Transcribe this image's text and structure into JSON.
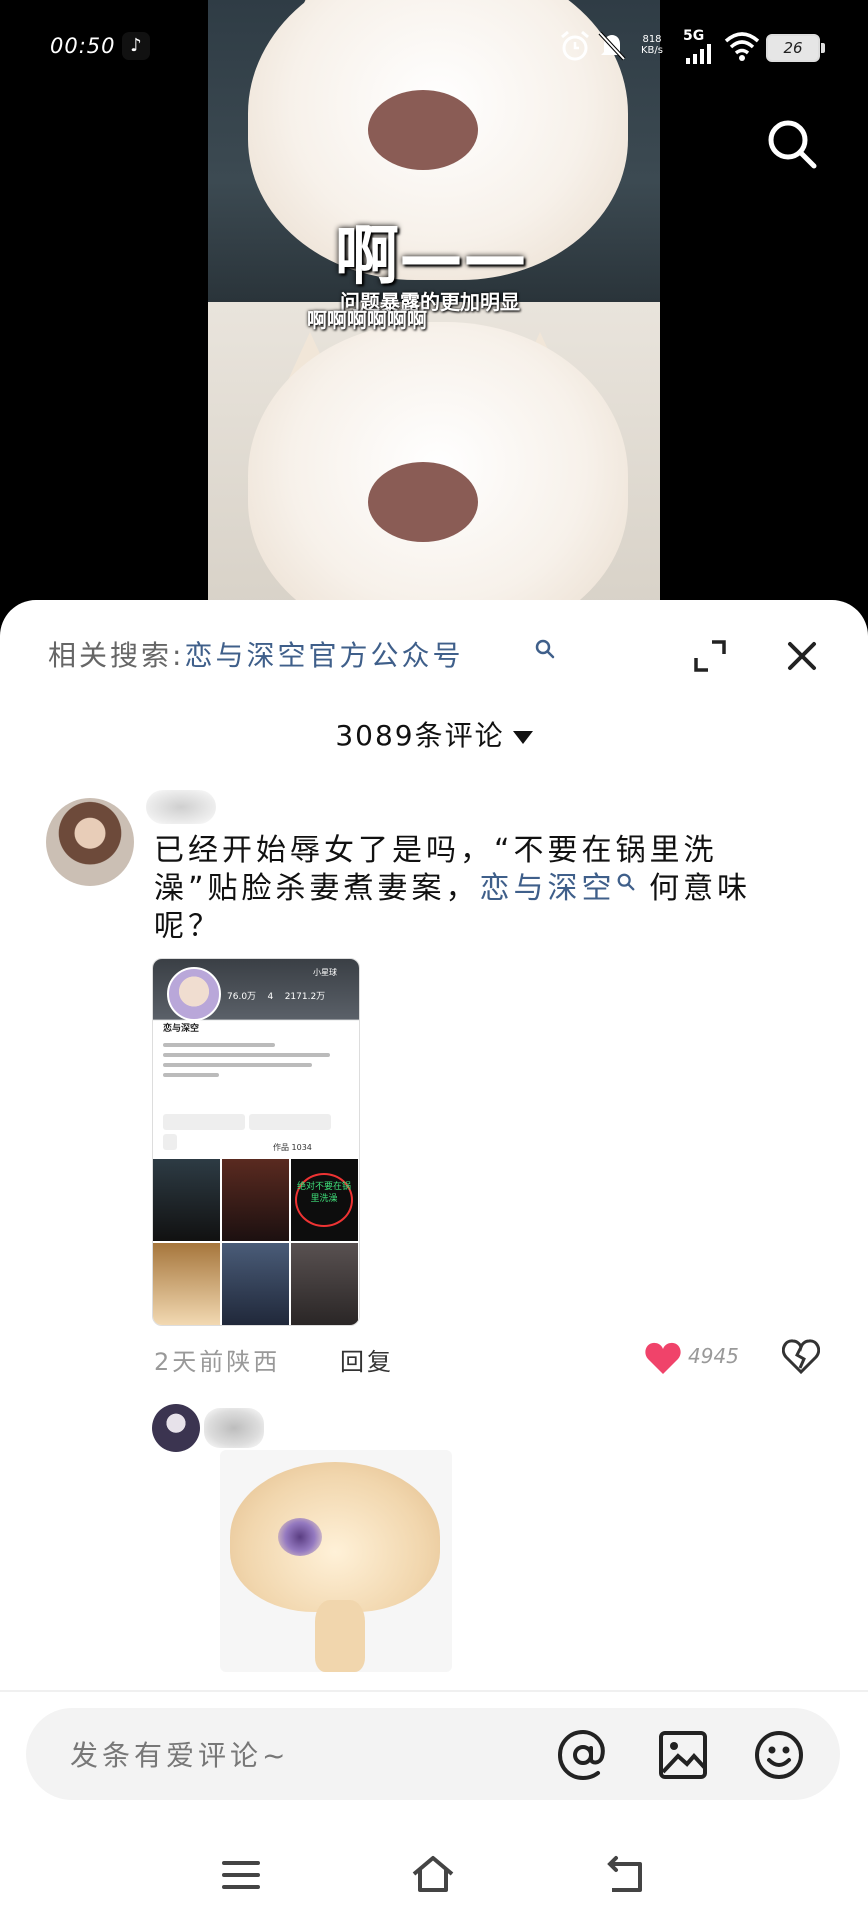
{
  "status_bar": {
    "time": "00:50",
    "speed_value": "818",
    "speed_unit": "KB/s",
    "network": "5G",
    "battery": "26"
  },
  "video": {
    "overlay_big": "啊——",
    "overlay_small": "问题暴露的更加明显",
    "overlay_small2": "啊啊啊啊啊啊"
  },
  "sheet": {
    "related_prefix": "相关搜索:",
    "related_term": "恋与深空官方公众号",
    "comment_count": "3089条评论"
  },
  "comment1": {
    "text_a": "已经开始辱女了是吗，“不要在锅里洗澡”贴脸杀妻煮妻案，",
    "text_link": "恋与深空",
    "text_b": " 何意味呢？",
    "meta": "2天前陕西",
    "reply": "回复",
    "likes": "4945",
    "screenshot": {
      "name": "恋与深空",
      "stats_a": "76.0万",
      "stats_b": "4",
      "stats_c": "2171.2万",
      "tag": "小星球",
      "works": "作品 1034",
      "overlay": "绝对不要在锅里洗澡"
    }
  },
  "input": {
    "placeholder": "发条有爱评论~"
  },
  "icons": {
    "heart_color": "#f0436a"
  }
}
